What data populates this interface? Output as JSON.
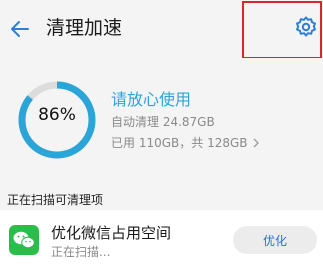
{
  "header": {
    "title": "清理加速"
  },
  "storage": {
    "percent_label": "86%",
    "percent_value": 0.86,
    "status": "请放心使用",
    "auto_cleaned": "自动清理 24.87GB",
    "usage": "已用 110GB，共 128GB"
  },
  "section": {
    "label": "正在扫描可清理项"
  },
  "item": {
    "title": "优化微信占用空间",
    "subtitle": "正在扫描...",
    "button_label": "优化"
  },
  "colors": {
    "accent": "#2ba5d8",
    "ring_track": "#dcdcdc",
    "highlight": "#d8262a",
    "wechat": "#2bbd4a"
  },
  "icons": {
    "back": "back-arrow-icon",
    "settings": "gear-icon",
    "wechat": "wechat-icon",
    "chevron": "chevron-right-icon"
  }
}
